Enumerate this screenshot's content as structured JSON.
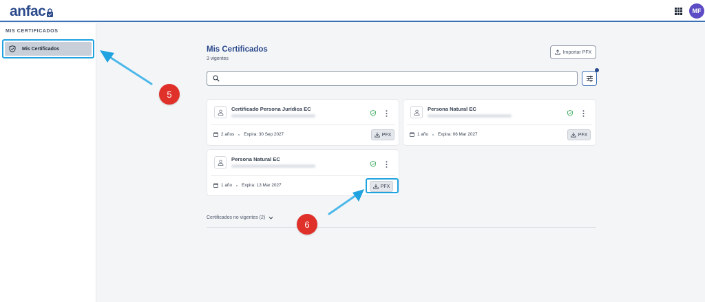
{
  "header": {
    "logo_text": "anfac",
    "apps_icon": "grid-apps-icon",
    "avatar_initials": "MF"
  },
  "sidebar": {
    "heading": "MIS CERTIFICADOS",
    "items": [
      {
        "label": "Mis Certificados",
        "icon": "shield-icon",
        "active": true
      }
    ]
  },
  "main": {
    "title": "Mis Certificados",
    "subtitle": "3 vigentes",
    "import_button": "Importar PFX",
    "search_placeholder": "",
    "certificates": [
      {
        "name": "Certificado Persona Jurídica EC",
        "duration": "2 años",
        "expiry": "Expira: 30 Sep 2027",
        "download_label": "PFX"
      },
      {
        "name": "Persona Natural EC",
        "duration": "1 año",
        "expiry": "Expira: 06 Mar 2027",
        "download_label": "PFX"
      },
      {
        "name": "Persona Natural EC",
        "duration": "1 año",
        "expiry": "Expira: 13 Mar 2027",
        "download_label": "PFX"
      }
    ],
    "expired_toggle": "Certificados no vigentes (2)"
  },
  "annotations": {
    "step_5": "5",
    "step_6": "6"
  },
  "colors": {
    "brand": "#2b4a8c",
    "highlight": "#1fa3e0",
    "badge": "#e0302a",
    "avatar": "#5b4bc4",
    "valid": "#3aa85b"
  }
}
